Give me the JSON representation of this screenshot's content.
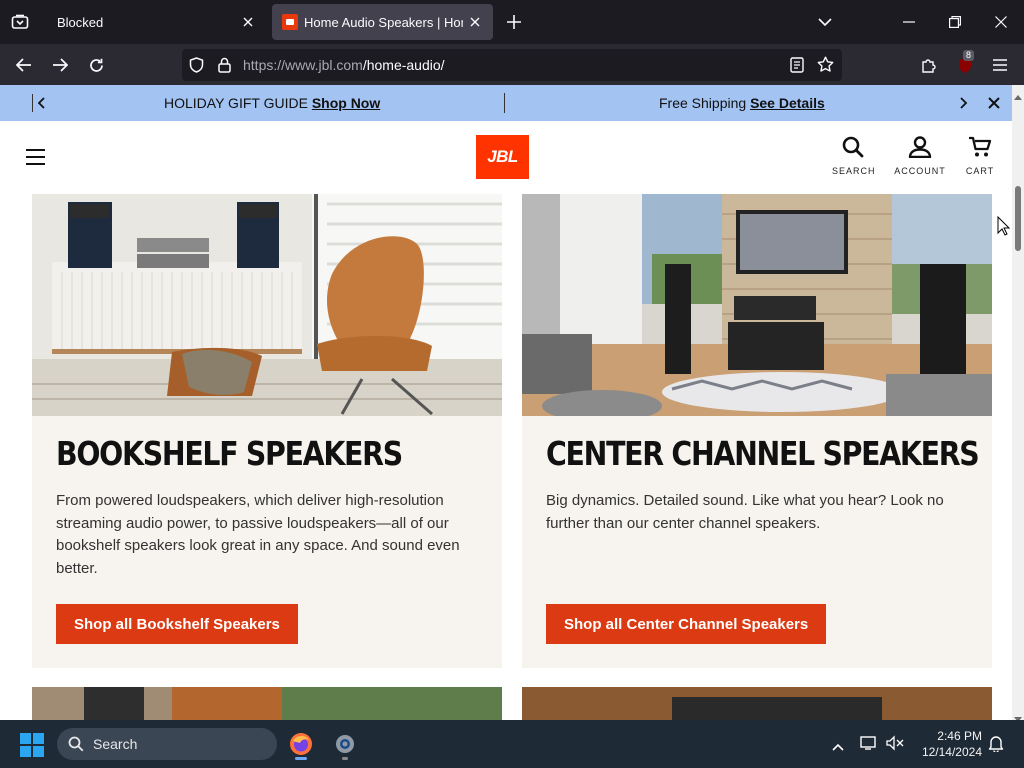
{
  "browser": {
    "tabs": [
      {
        "title": "Blocked",
        "active": false
      },
      {
        "title": "Home Audio Speakers | Home",
        "active": true
      }
    ],
    "url_host": "https://www.jbl.com",
    "url_path": "/home-audio/",
    "extension_badge": "8"
  },
  "promo_bar": {
    "left_text": "HOLIDAY GIFT GUIDE",
    "left_link": "Shop Now",
    "right_text": "Free Shipping",
    "right_link": "See Details"
  },
  "header": {
    "logo_text": "JBL",
    "search_label": "SEARCH",
    "account_label": "ACCOUNT",
    "cart_label": "CART"
  },
  "cards": [
    {
      "title": "BOOKSHELF SPEAKERS",
      "description": "From powered loudspeakers, which deliver high-resolution streaming audio power, to passive loudspeakers—all of our bookshelf speakers look great in any space. And sound even better.",
      "button": "Shop all Bookshelf Speakers"
    },
    {
      "title": "CENTER CHANNEL SPEAKERS",
      "description": "Big dynamics. Detailed sound. Like what you hear? Look no further than our center channel speakers.",
      "button": "Shop all Center Channel Speakers"
    }
  ],
  "taskbar": {
    "search_placeholder": "Search",
    "time": "2:46 PM",
    "date": "12/14/2024"
  },
  "colors": {
    "jbl_orange": "#ff3300",
    "button_red": "#dc3a12",
    "promo_blue": "#a3c4f3",
    "card_bg": "#f7f3ee"
  }
}
